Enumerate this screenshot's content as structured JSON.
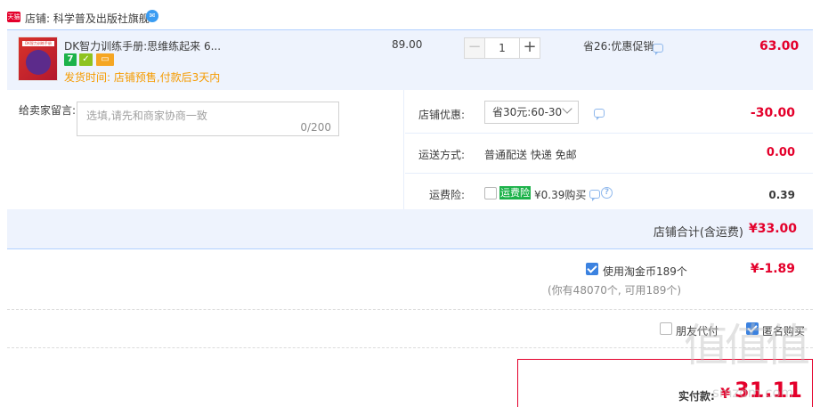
{
  "shop": {
    "icon_label": "天猫",
    "label": "店铺: 科学普及出版社旗舰",
    "ww_icon": "wangwang-chat-icon"
  },
  "item": {
    "title": "DK智力训练手册:思维练起来 6...",
    "thumb_text": "DK智力训练手册",
    "tags": [
      "7",
      "✓",
      "▭"
    ],
    "ship_time": "发货时间: 店铺预售,付款后3天内",
    "unit_price": "89.00",
    "quantity": "1",
    "minus": "−",
    "plus": "+",
    "promo": "省26:优惠促销",
    "total": "63.00"
  },
  "message": {
    "label": "给卖家留言:",
    "placeholder": "选填,请先和商家协商一致",
    "counter": "0/200"
  },
  "discount": {
    "label": "店铺优惠:",
    "selected": "省30元:60-30",
    "amount": "-30.00"
  },
  "shipping": {
    "label": "运送方式:",
    "value": "普通配送 快递 免邮",
    "amount": "0.00"
  },
  "insurance": {
    "label": "运费险:",
    "badge": "运费险",
    "price": "¥0.39购买",
    "help": "?",
    "amount": "0.39"
  },
  "shop_total": {
    "label": "店铺合计(含运费)",
    "amount": "¥33.00"
  },
  "coins": {
    "label": "使用淘金币189个",
    "note": "(你有48070个, 可用189个)",
    "amount": "¥-1.89"
  },
  "options": {
    "friend_pay": "朋友代付",
    "anonymous": "匿名购买"
  },
  "pay": {
    "label": "实付款:",
    "currency": "¥",
    "amount": "31.11"
  },
  "watermark": {
    "text": "值值值",
    "url": "smzdm.com"
  },
  "colors": {
    "accent_red": "#e4002b",
    "row_bg": "#eef3fd",
    "check_blue": "#3b82e0",
    "ship_time_orange": "#f59b00"
  }
}
